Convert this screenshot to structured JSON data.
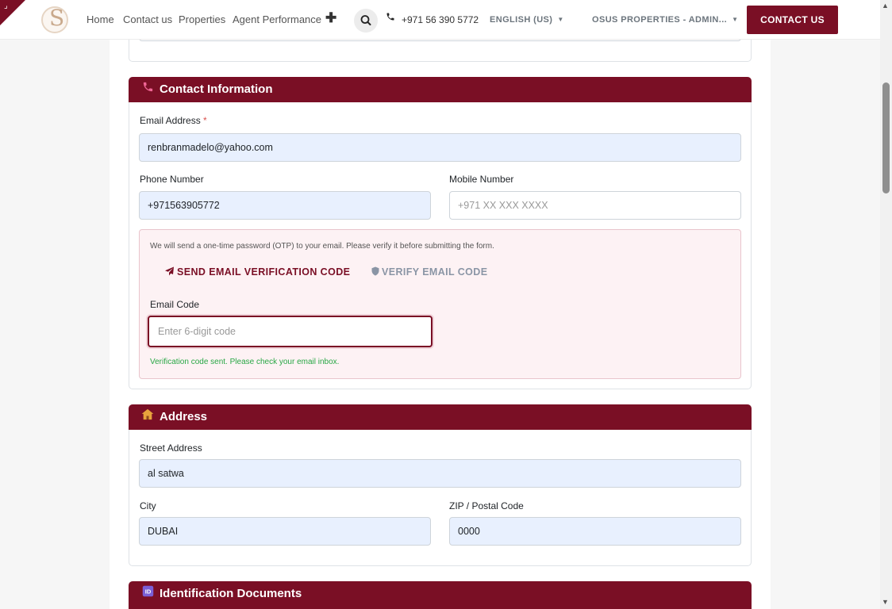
{
  "header": {
    "logo_letter": "S",
    "nav": [
      "Home",
      "Contact us",
      "Properties",
      "Agent Performance"
    ],
    "add_glyph": "✚",
    "phone": "+971 56 390 5772",
    "language": "ENGLISH (US)",
    "account": "OSUS PROPERTIES - ADMIN...",
    "cta": "CONTACT US"
  },
  "contact": {
    "title": "Contact Information",
    "email_label": "Email Address",
    "required_mark": "*",
    "email_value": "renbranmadelo@yahoo.com",
    "phone_label": "Phone Number",
    "phone_value": "+971563905772",
    "mobile_label": "Mobile Number",
    "mobile_placeholder": "+971 XX XXX XXXX",
    "otp_note": "We will send a one-time password (OTP) to your email. Please verify it before submitting the form.",
    "send_btn": "SEND EMAIL VERIFICATION CODE",
    "verify_btn": "VERIFY EMAIL CODE",
    "code_label": "Email Code",
    "code_placeholder": "Enter 6-digit code",
    "success_msg": "Verification code sent. Please check your email inbox."
  },
  "address": {
    "title": "Address",
    "street_label": "Street Address",
    "street_value": "al satwa",
    "city_label": "City",
    "city_value": "DUBAI",
    "zip_label": "ZIP / Postal Code",
    "zip_value": "0000"
  },
  "identification": {
    "title": "Identification Documents"
  },
  "colors": {
    "brand": "#7a0f25",
    "field_fill": "#e8f0fe",
    "success": "#28a745"
  }
}
